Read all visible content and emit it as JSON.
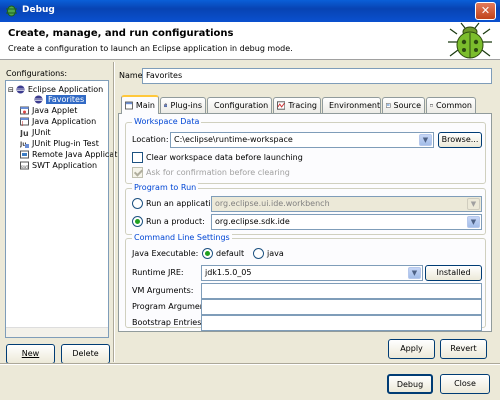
{
  "window": {
    "title": "Debug"
  },
  "header": {
    "title": "Create, manage, and run configurations",
    "subtitle": "Create a configuration to launch an Eclipse application in debug mode."
  },
  "configurations": {
    "label": "Configurations:",
    "items": [
      {
        "label": "Eclipse Application",
        "icon": "eclipse-icon"
      },
      {
        "label": "Favorites",
        "icon": "eclipse-icon",
        "selected": true
      },
      {
        "label": "Java Applet",
        "icon": "applet-icon"
      },
      {
        "label": "Java Application",
        "icon": "java-app-icon"
      },
      {
        "label": "JUnit",
        "icon": "junit-icon"
      },
      {
        "label": "JUnit Plug-in Test",
        "icon": "junit-plugin-icon"
      },
      {
        "label": "Remote Java Applicati",
        "icon": "remote-java-icon"
      },
      {
        "label": "SWT Application",
        "icon": "swt-icon"
      }
    ],
    "new_label": "New",
    "delete_label": "Delete"
  },
  "name": {
    "label": "Name:",
    "value": "Favorites"
  },
  "tabs": [
    {
      "label": "Main",
      "icon": "main-tab-icon",
      "active": true
    },
    {
      "label": "Plug-ins",
      "icon": "plugins-icon"
    },
    {
      "label": "Configuration",
      "icon": "configuration-icon"
    },
    {
      "label": "Tracing",
      "icon": "tracing-icon"
    },
    {
      "label": "Environment",
      "icon": "environment-icon"
    },
    {
      "label": "Source",
      "icon": "source-icon"
    },
    {
      "label": "Common",
      "icon": "common-icon"
    }
  ],
  "workspace": {
    "title": "Workspace Data",
    "location_label": "Location:",
    "location_value": "C:\\eclipse\\runtime-workspace",
    "browse_label": "Browse...",
    "clear_label": "Clear workspace data before launching",
    "ask_label": "Ask for confirmation before clearing"
  },
  "program": {
    "title": "Program to Run",
    "application_label": "Run an application:",
    "application_value": "org.eclipse.ui.ide.workbench",
    "product_label": "Run a product:",
    "product_value": "org.eclipse.sdk.ide"
  },
  "cmdline": {
    "title": "Command Line Settings",
    "java_exec_label": "Java Executable:",
    "default_label": "default",
    "java_label": "java",
    "jre_label": "Runtime JRE:",
    "jre_value": "jdk1.5.0_05",
    "installed_jres_label": "Installed JREs...",
    "vm_args_label": "VM Arguments:",
    "program_args_label": "Program Arguments:",
    "bootstrap_label": "Bootstrap Entries:"
  },
  "actions": {
    "apply_label": "Apply",
    "revert_label": "Revert",
    "debug_label": "Debug",
    "close_label": "Close"
  },
  "colors": {
    "titlebar": "#0a50cf",
    "selection": "#316ac5",
    "group_title": "#0046d5"
  }
}
